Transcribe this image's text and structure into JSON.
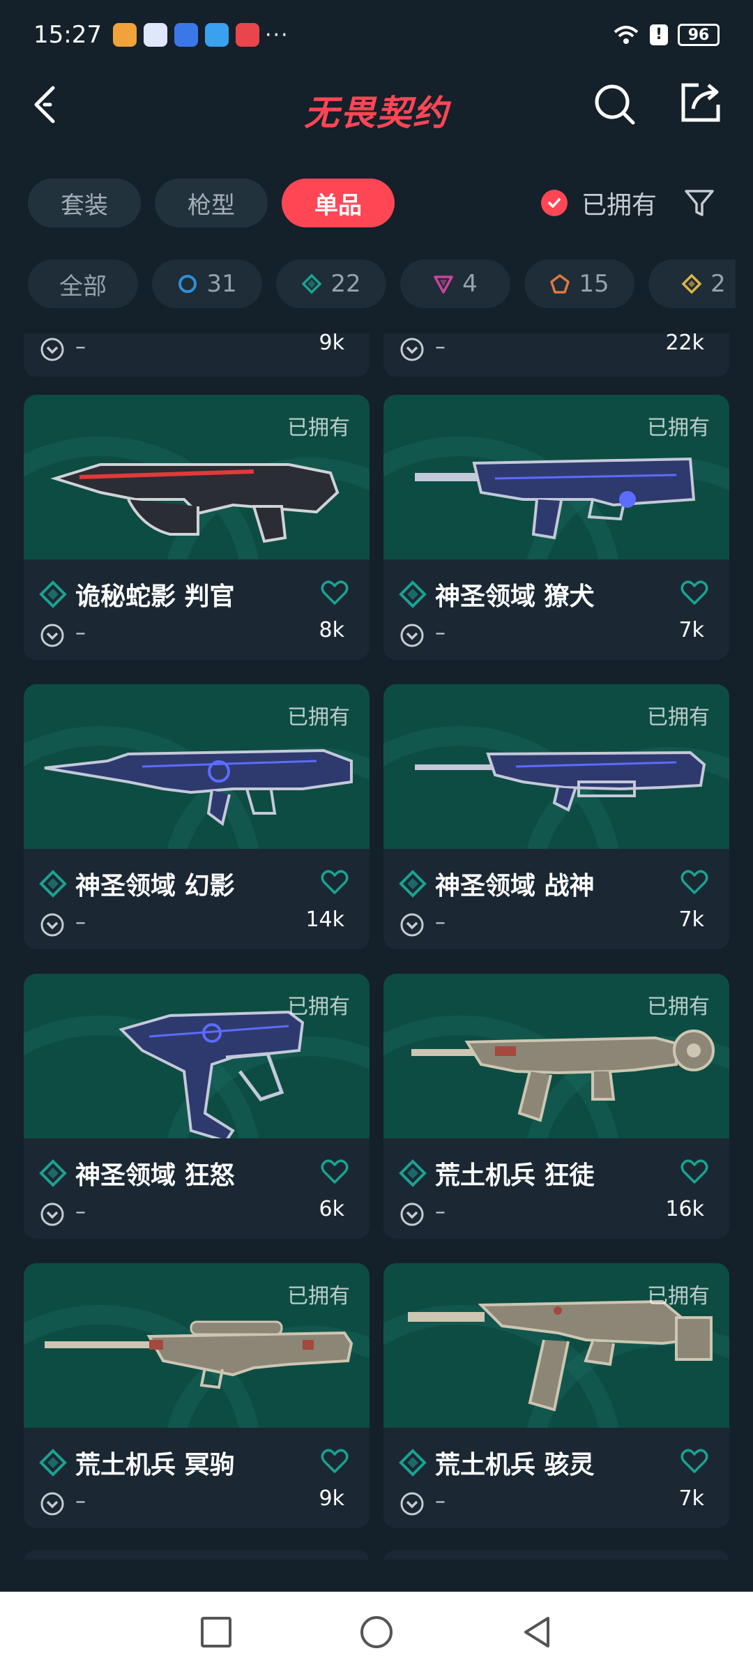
{
  "status_bar": {
    "time": "15:27",
    "more": "···",
    "alert": "!",
    "battery": "96"
  },
  "header": {
    "title": "无畏契约"
  },
  "tabs": [
    {
      "label": "套装",
      "active": false
    },
    {
      "label": "枪型",
      "active": false
    },
    {
      "label": "单品",
      "active": true
    }
  ],
  "owned_filter": {
    "label": "已拥有",
    "checked": true
  },
  "chips": [
    {
      "label": "全部",
      "icon": "",
      "color": ""
    },
    {
      "label": "31",
      "icon": "ring-icon",
      "color": "#2f8fd8"
    },
    {
      "label": "22",
      "icon": "diamond-icon",
      "color": "#1aa292"
    },
    {
      "label": "4",
      "icon": "triangle-icon",
      "color": "#c9459a"
    },
    {
      "label": "15",
      "icon": "pentagon-icon",
      "color": "#e07a3a"
    },
    {
      "label": "2",
      "icon": "gold-diamond-icon",
      "color": "#e0b341"
    }
  ],
  "partial_top": [
    {
      "level": "–",
      "likes": "9k"
    },
    {
      "level": "–",
      "likes": "22k"
    }
  ],
  "cards": [
    {
      "owned_label": "已拥有",
      "name": "诡秘蛇影 判官",
      "level": "–",
      "likes": "8k",
      "weapon": "shotgun",
      "palette": "dark"
    },
    {
      "owned_label": "已拥有",
      "name": "神圣领域 獠犬",
      "level": "–",
      "likes": "7k",
      "weapon": "bulldog",
      "palette": "blue"
    },
    {
      "owned_label": "已拥有",
      "name": "神圣领域 幻影",
      "level": "–",
      "likes": "14k",
      "weapon": "phantom",
      "palette": "blue"
    },
    {
      "owned_label": "已拥有",
      "name": "神圣领域 战神",
      "level": "–",
      "likes": "7k",
      "weapon": "ares",
      "palette": "blue"
    },
    {
      "owned_label": "已拥有",
      "name": "神圣领域 狂怒",
      "level": "–",
      "likes": "6k",
      "weapon": "frenzy",
      "palette": "blue"
    },
    {
      "owned_label": "已拥有",
      "name": "荒土机兵 狂徒",
      "level": "–",
      "likes": "16k",
      "weapon": "vandal",
      "palette": "tan"
    },
    {
      "owned_label": "已拥有",
      "name": "荒土机兵 冥驹",
      "level": "–",
      "likes": "9k",
      "weapon": "operator",
      "palette": "tan"
    },
    {
      "owned_label": "已拥有",
      "name": "荒土机兵 骇灵",
      "level": "–",
      "likes": "7k",
      "weapon": "spectre",
      "palette": "tan"
    }
  ],
  "colors": {
    "accent": "#ff4655",
    "background": "#14202a",
    "card": "#1b2833",
    "card_image": "#0d4c43",
    "tier_green": "#1aa292"
  }
}
